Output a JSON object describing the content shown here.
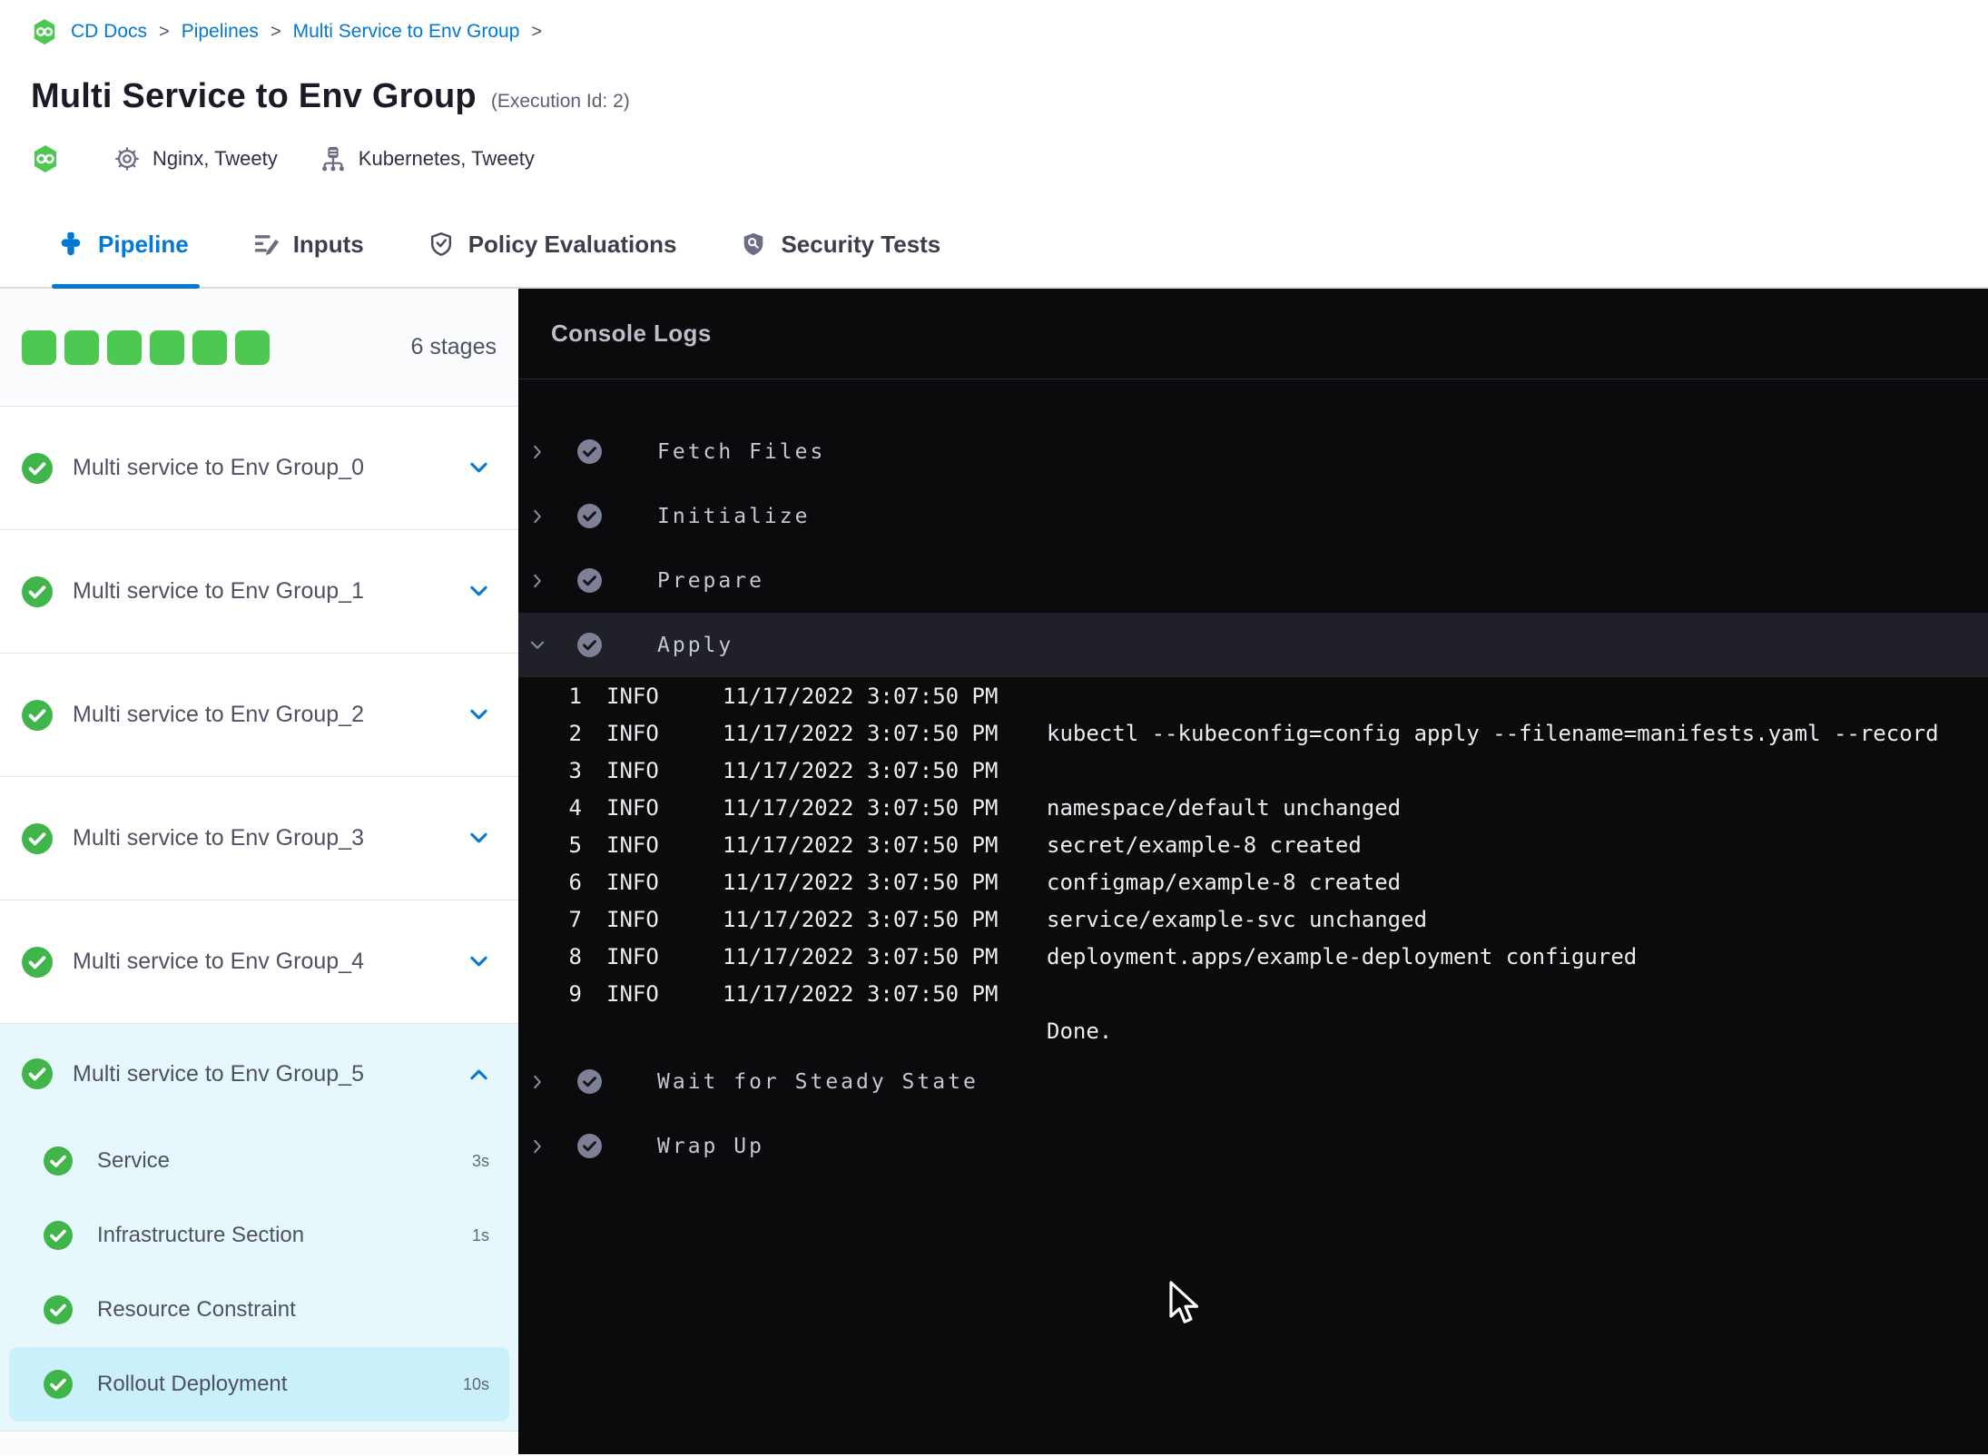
{
  "breadcrumb": {
    "items": [
      "CD Docs",
      "Pipelines",
      "Multi Service to Env Group"
    ],
    "separator": ">"
  },
  "page": {
    "title": "Multi Service to Env Group",
    "execution_id": "(Execution Id: 2)"
  },
  "meta": {
    "services_label": "Nginx, Tweety",
    "environments_label": "Kubernetes, Tweety"
  },
  "tabs": [
    {
      "id": "pipeline",
      "label": "Pipeline",
      "active": true
    },
    {
      "id": "inputs",
      "label": "Inputs",
      "active": false
    },
    {
      "id": "policy-evaluations",
      "label": "Policy Evaluations",
      "active": false
    },
    {
      "id": "security-tests",
      "label": "Security Tests",
      "active": false
    }
  ],
  "sidebar": {
    "stage_count_label": "6 stages",
    "stages": [
      {
        "label": "Multi service to Env Group_0",
        "status": "success",
        "expanded": false
      },
      {
        "label": "Multi service to Env Group_1",
        "status": "success",
        "expanded": false
      },
      {
        "label": "Multi service to Env Group_2",
        "status": "success",
        "expanded": false
      },
      {
        "label": "Multi service to Env Group_3",
        "status": "success",
        "expanded": false
      },
      {
        "label": "Multi service to Env Group_4",
        "status": "success",
        "expanded": false
      },
      {
        "label": "Multi service to Env Group_5",
        "status": "success",
        "expanded": true,
        "steps": [
          {
            "label": "Service",
            "duration": "3s",
            "selected": false
          },
          {
            "label": "Infrastructure Section",
            "duration": "1s",
            "selected": false
          },
          {
            "label": "Resource Constraint",
            "duration": "",
            "selected": false
          },
          {
            "label": "Rollout Deployment",
            "duration": "10s",
            "selected": true
          }
        ]
      }
    ]
  },
  "console": {
    "title": "Console Logs",
    "steps": [
      {
        "label": "Fetch Files",
        "status": "success",
        "expanded": false
      },
      {
        "label": "Initialize",
        "status": "success",
        "expanded": false
      },
      {
        "label": "Prepare",
        "status": "success",
        "expanded": false
      },
      {
        "label": "Apply",
        "status": "success",
        "expanded": true,
        "logs": [
          {
            "n": "1",
            "level": "INFO",
            "time": "11/17/2022 3:07:50 PM",
            "message": ""
          },
          {
            "n": "2",
            "level": "INFO",
            "time": "11/17/2022 3:07:50 PM",
            "message": "kubectl --kubeconfig=config apply --filename=manifests.yaml --record"
          },
          {
            "n": "3",
            "level": "INFO",
            "time": "11/17/2022 3:07:50 PM",
            "message": ""
          },
          {
            "n": "4",
            "level": "INFO",
            "time": "11/17/2022 3:07:50 PM",
            "message": "namespace/default unchanged"
          },
          {
            "n": "5",
            "level": "INFO",
            "time": "11/17/2022 3:07:50 PM",
            "message": "secret/example-8 created"
          },
          {
            "n": "6",
            "level": "INFO",
            "time": "11/17/2022 3:07:50 PM",
            "message": "configmap/example-8 created"
          },
          {
            "n": "7",
            "level": "INFO",
            "time": "11/17/2022 3:07:50 PM",
            "message": "service/example-svc unchanged"
          },
          {
            "n": "8",
            "level": "INFO",
            "time": "11/17/2022 3:07:50 PM",
            "message": "deployment.apps/example-deployment configured"
          },
          {
            "n": "9",
            "level": "INFO",
            "time": "11/17/2022 3:07:50 PM",
            "message": ""
          },
          {
            "n": "",
            "level": "",
            "time": "",
            "message": "Done."
          }
        ]
      },
      {
        "label": "Wait for Steady State",
        "status": "success",
        "expanded": false
      },
      {
        "label": "Wrap Up",
        "status": "success",
        "expanded": false
      }
    ]
  },
  "colors": {
    "accent_blue": "#0278d5",
    "success_green": "#4dc952",
    "check_green": "#3fb54a",
    "console_bg": "#0b0b0e",
    "console_row_highlight": "#1f2028",
    "expanded_stage_bg": "#e7f8fd",
    "selected_step_bg": "#c9f0fb",
    "muted_icon_gray": "#6b6d85",
    "console_step_icon": "#7d8096"
  }
}
